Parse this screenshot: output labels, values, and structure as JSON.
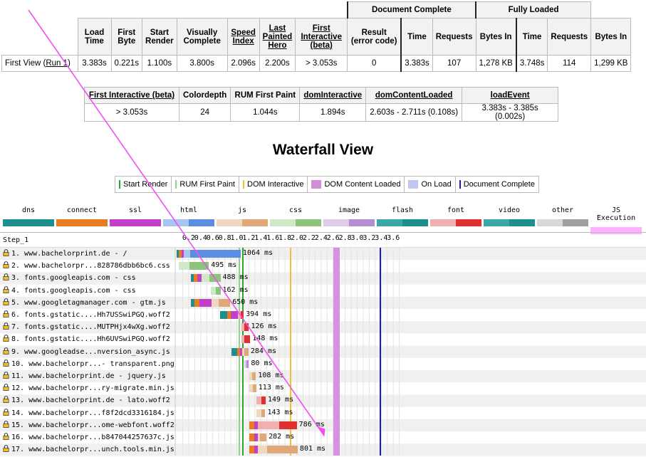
{
  "summary": {
    "groups": {
      "doc_complete": "Document Complete",
      "fully_loaded": "Fully Loaded"
    },
    "headers": [
      "Load Time",
      "First Byte",
      "Start Render",
      "Visually Complete",
      "Speed Index",
      "Last Painted Hero",
      "First Interactive (beta)",
      "Result (error code)",
      "Time",
      "Requests",
      "Bytes In",
      "Time",
      "Requests",
      "Bytes In"
    ],
    "row_label": "First View",
    "run_link": "Run 1",
    "values": [
      "3.383s",
      "0.221s",
      "1.100s",
      "3.800s",
      "2.096s",
      "2.200s",
      "> 3.053s",
      "0",
      "3.383s",
      "107",
      "1,278 KB",
      "3.748s",
      "114",
      "1,299 KB"
    ]
  },
  "interactive": {
    "headers": [
      "First Interactive (beta)",
      "Colordepth",
      "RUM First Paint",
      "domInteractive",
      "domContentLoaded",
      "loadEvent"
    ],
    "values": [
      "> 3.053s",
      "24",
      "1.044s",
      "1.894s",
      "2.603s - 2.711s (0.108s)",
      "3.383s - 3.385s (0.002s)"
    ]
  },
  "waterfall_title": "Waterfall View",
  "milestones_legend": [
    {
      "label": "Start Render",
      "color": "#28a828",
      "kind": "line"
    },
    {
      "label": "RUM First Paint",
      "color": "#8fd18f",
      "kind": "line"
    },
    {
      "label": "DOM Interactive",
      "color": "#f0c030",
      "kind": "line"
    },
    {
      "label": "DOM Content Loaded",
      "color": "#d08ed8",
      "kind": "box"
    },
    {
      "label": "On Load",
      "color": "#c0c8f0",
      "kind": "box"
    },
    {
      "label": "Document Complete",
      "color": "#1a1ac8",
      "kind": "line"
    }
  ],
  "type_legend": [
    {
      "label": "dns",
      "color": "#1e8e8e"
    },
    {
      "label": "connect",
      "color": "#e87c20"
    },
    {
      "label": "ssl",
      "color": "#c040c8"
    },
    {
      "label": "html",
      "color": "#a8c4f0",
      "dark": "#5a8ee0"
    },
    {
      "label": "js",
      "color": "#f0d8c0",
      "dark": "#e0a878"
    },
    {
      "label": "css",
      "color": "#cfe8c8",
      "dark": "#8cc47c"
    },
    {
      "label": "image",
      "color": "#dccce8",
      "dark": "#b48ed0"
    },
    {
      "label": "flash",
      "color": "#3aa8a8",
      "dark": "#1e8e8e"
    },
    {
      "label": "font",
      "color": "#f0b0b0",
      "dark": "#e03030"
    },
    {
      "label": "video",
      "color": "#3aa8a8",
      "dark": "#1e8e8e"
    },
    {
      "label": "other",
      "color": "#d8d8d8",
      "dark": "#a0a0a0"
    },
    {
      "label": "JS Execution",
      "color": "#ffb0ff",
      "dark": "#ffb0ff"
    }
  ],
  "waterfall": {
    "step_label": "Step_1",
    "ticks": [
      "0.2",
      "0.4",
      "0.6",
      "0.8",
      "1.0",
      "1.2",
      "1.4",
      "1.6",
      "1.8",
      "2.0",
      "2.2",
      "2.4",
      "2.6",
      "2.8",
      "3.0",
      "3.2",
      "3.4",
      "3.6"
    ],
    "requests": [
      {
        "label": "1. www.bachelorprint.de - /",
        "ms": "1064 ms",
        "type": "html",
        "start": 0.0,
        "dns": 0.04,
        "connect": 0.04,
        "ssl": 0.04,
        "ttfb_end": 0.221,
        "end": 1.064,
        "js_exec": []
      },
      {
        "label": "2. www.bachelorpr...828786dbb6bc6.css",
        "ms": "495 ms",
        "type": "css",
        "start": 0.04,
        "dns": 0,
        "connect": 0,
        "ssl": 0,
        "ttfb_end": 0.21,
        "end": 0.535,
        "js_exec": []
      },
      {
        "label": "3. fonts.googleapis.com - css",
        "ms": "488 ms",
        "type": "css",
        "start": 0.24,
        "dns": 0.04,
        "connect": 0.06,
        "ssl": 0.08,
        "ttfb_end": 0.55,
        "end": 0.728,
        "js_exec": []
      },
      {
        "label": "4. fonts.googleapis.com - css",
        "ms": "162 ms",
        "type": "css",
        "start": 0.566,
        "dns": 0,
        "connect": 0,
        "ssl": 0,
        "ttfb_end": 0.65,
        "end": 0.728,
        "js_exec": []
      },
      {
        "label": "5. www.googletagmanager.com - gtm.js",
        "ms": "650 ms",
        "type": "js",
        "start": 0.24,
        "dns": 0.06,
        "connect": 0.08,
        "ssl": 0.2,
        "ttfb_end": 0.7,
        "end": 0.89,
        "js_exec": []
      },
      {
        "label": "6. fonts.gstatic....Hh7USSwiPGQ.woff2",
        "ms": "394 ms",
        "type": "font",
        "start": 0.72,
        "dns": 0.12,
        "connect": 0.06,
        "ssl": 0.12,
        "ttfb_end": 1.07,
        "end": 1.114,
        "js_exec": []
      },
      {
        "label": "7. fonts.gstatic....MUTPHjx4wXg.woff2",
        "ms": "126 ms",
        "type": "font",
        "start": 1.075,
        "dns": 0,
        "connect": 0,
        "ssl": 0,
        "ttfb_end": 1.13,
        "end": 1.201,
        "js_exec": []
      },
      {
        "label": "8. fonts.gstatic....Hh6UVSwiPGQ.woff2",
        "ms": "148 ms",
        "type": "font",
        "start": 1.075,
        "dns": 0,
        "connect": 0,
        "ssl": 0,
        "ttfb_end": 1.12,
        "end": 1.223,
        "js_exec": []
      },
      {
        "label": "9. www.googleadse...nversion_async.js",
        "ms": "284 ms",
        "type": "js",
        "start": 0.91,
        "dns": 0.1,
        "connect": 0.04,
        "ssl": 0.04,
        "ttfb_end": 1.12,
        "end": 1.194,
        "js_exec": []
      },
      {
        "label": "10. www.bachelorpr...- transparent.png",
        "ms": "80 ms",
        "type": "image",
        "start": 1.12,
        "dns": 0,
        "connect": 0,
        "ssl": 0,
        "ttfb_end": 1.16,
        "end": 1.2,
        "js_exec": []
      },
      {
        "label": "11. www.bachelorprint.de - jquery.js",
        "ms": "108 ms",
        "type": "js",
        "start": 1.21,
        "dns": 0,
        "connect": 0,
        "ssl": 0,
        "ttfb_end": 1.26,
        "end": 1.318,
        "js_exec": []
      },
      {
        "label": "12. www.bachelorpr...ry-migrate.min.js",
        "ms": "113 ms",
        "type": "js",
        "start": 1.21,
        "dns": 0,
        "connect": 0,
        "ssl": 0,
        "ttfb_end": 1.27,
        "end": 1.323,
        "js_exec": []
      },
      {
        "label": "13. www.bachelorprint.de - lato.woff2",
        "ms": "149 ms",
        "type": "font",
        "start": 1.33,
        "dns": 0,
        "connect": 0,
        "ssl": 0,
        "ttfb_end": 1.41,
        "end": 1.479,
        "js_exec": []
      },
      {
        "label": "14. www.bachelorpr...f8f2dcd3316184.js",
        "ms": "143 ms",
        "type": "js",
        "start": 1.33,
        "dns": 0,
        "connect": 0,
        "ssl": 0,
        "ttfb_end": 1.41,
        "end": 1.473,
        "js_exec": []
      },
      {
        "label": "15. www.bachelorpr...ome-webfont.woff2",
        "ms": "786 ms",
        "type": "font",
        "start": 1.21,
        "dns": 0,
        "connect": 0.08,
        "ssl": 0.06,
        "ttfb_end": 1.7,
        "end": 1.996,
        "js_exec": []
      },
      {
        "label": "16. www.bachelorpr...b847044257637c.js",
        "ms": "282 ms",
        "type": "js",
        "start": 1.21,
        "dns": 0,
        "connect": 0.08,
        "ssl": 0.06,
        "ttfb_end": 1.38,
        "end": 1.492,
        "js_exec": []
      },
      {
        "label": "17. www.bachelorpr...unch.tools.min.js",
        "ms": "801 ms",
        "type": "js",
        "start": 1.21,
        "dns": 0,
        "connect": 0.08,
        "ssl": 0.06,
        "ttfb_end": 1.5,
        "end": 2.011,
        "js_exec": []
      }
    ],
    "markers": {
      "start_render": 1.1,
      "rum_first_paint": 1.044,
      "dom_interactive": 1.894,
      "dcl_start": 2.603,
      "dcl_end": 2.711,
      "doc_complete": 3.383
    }
  }
}
